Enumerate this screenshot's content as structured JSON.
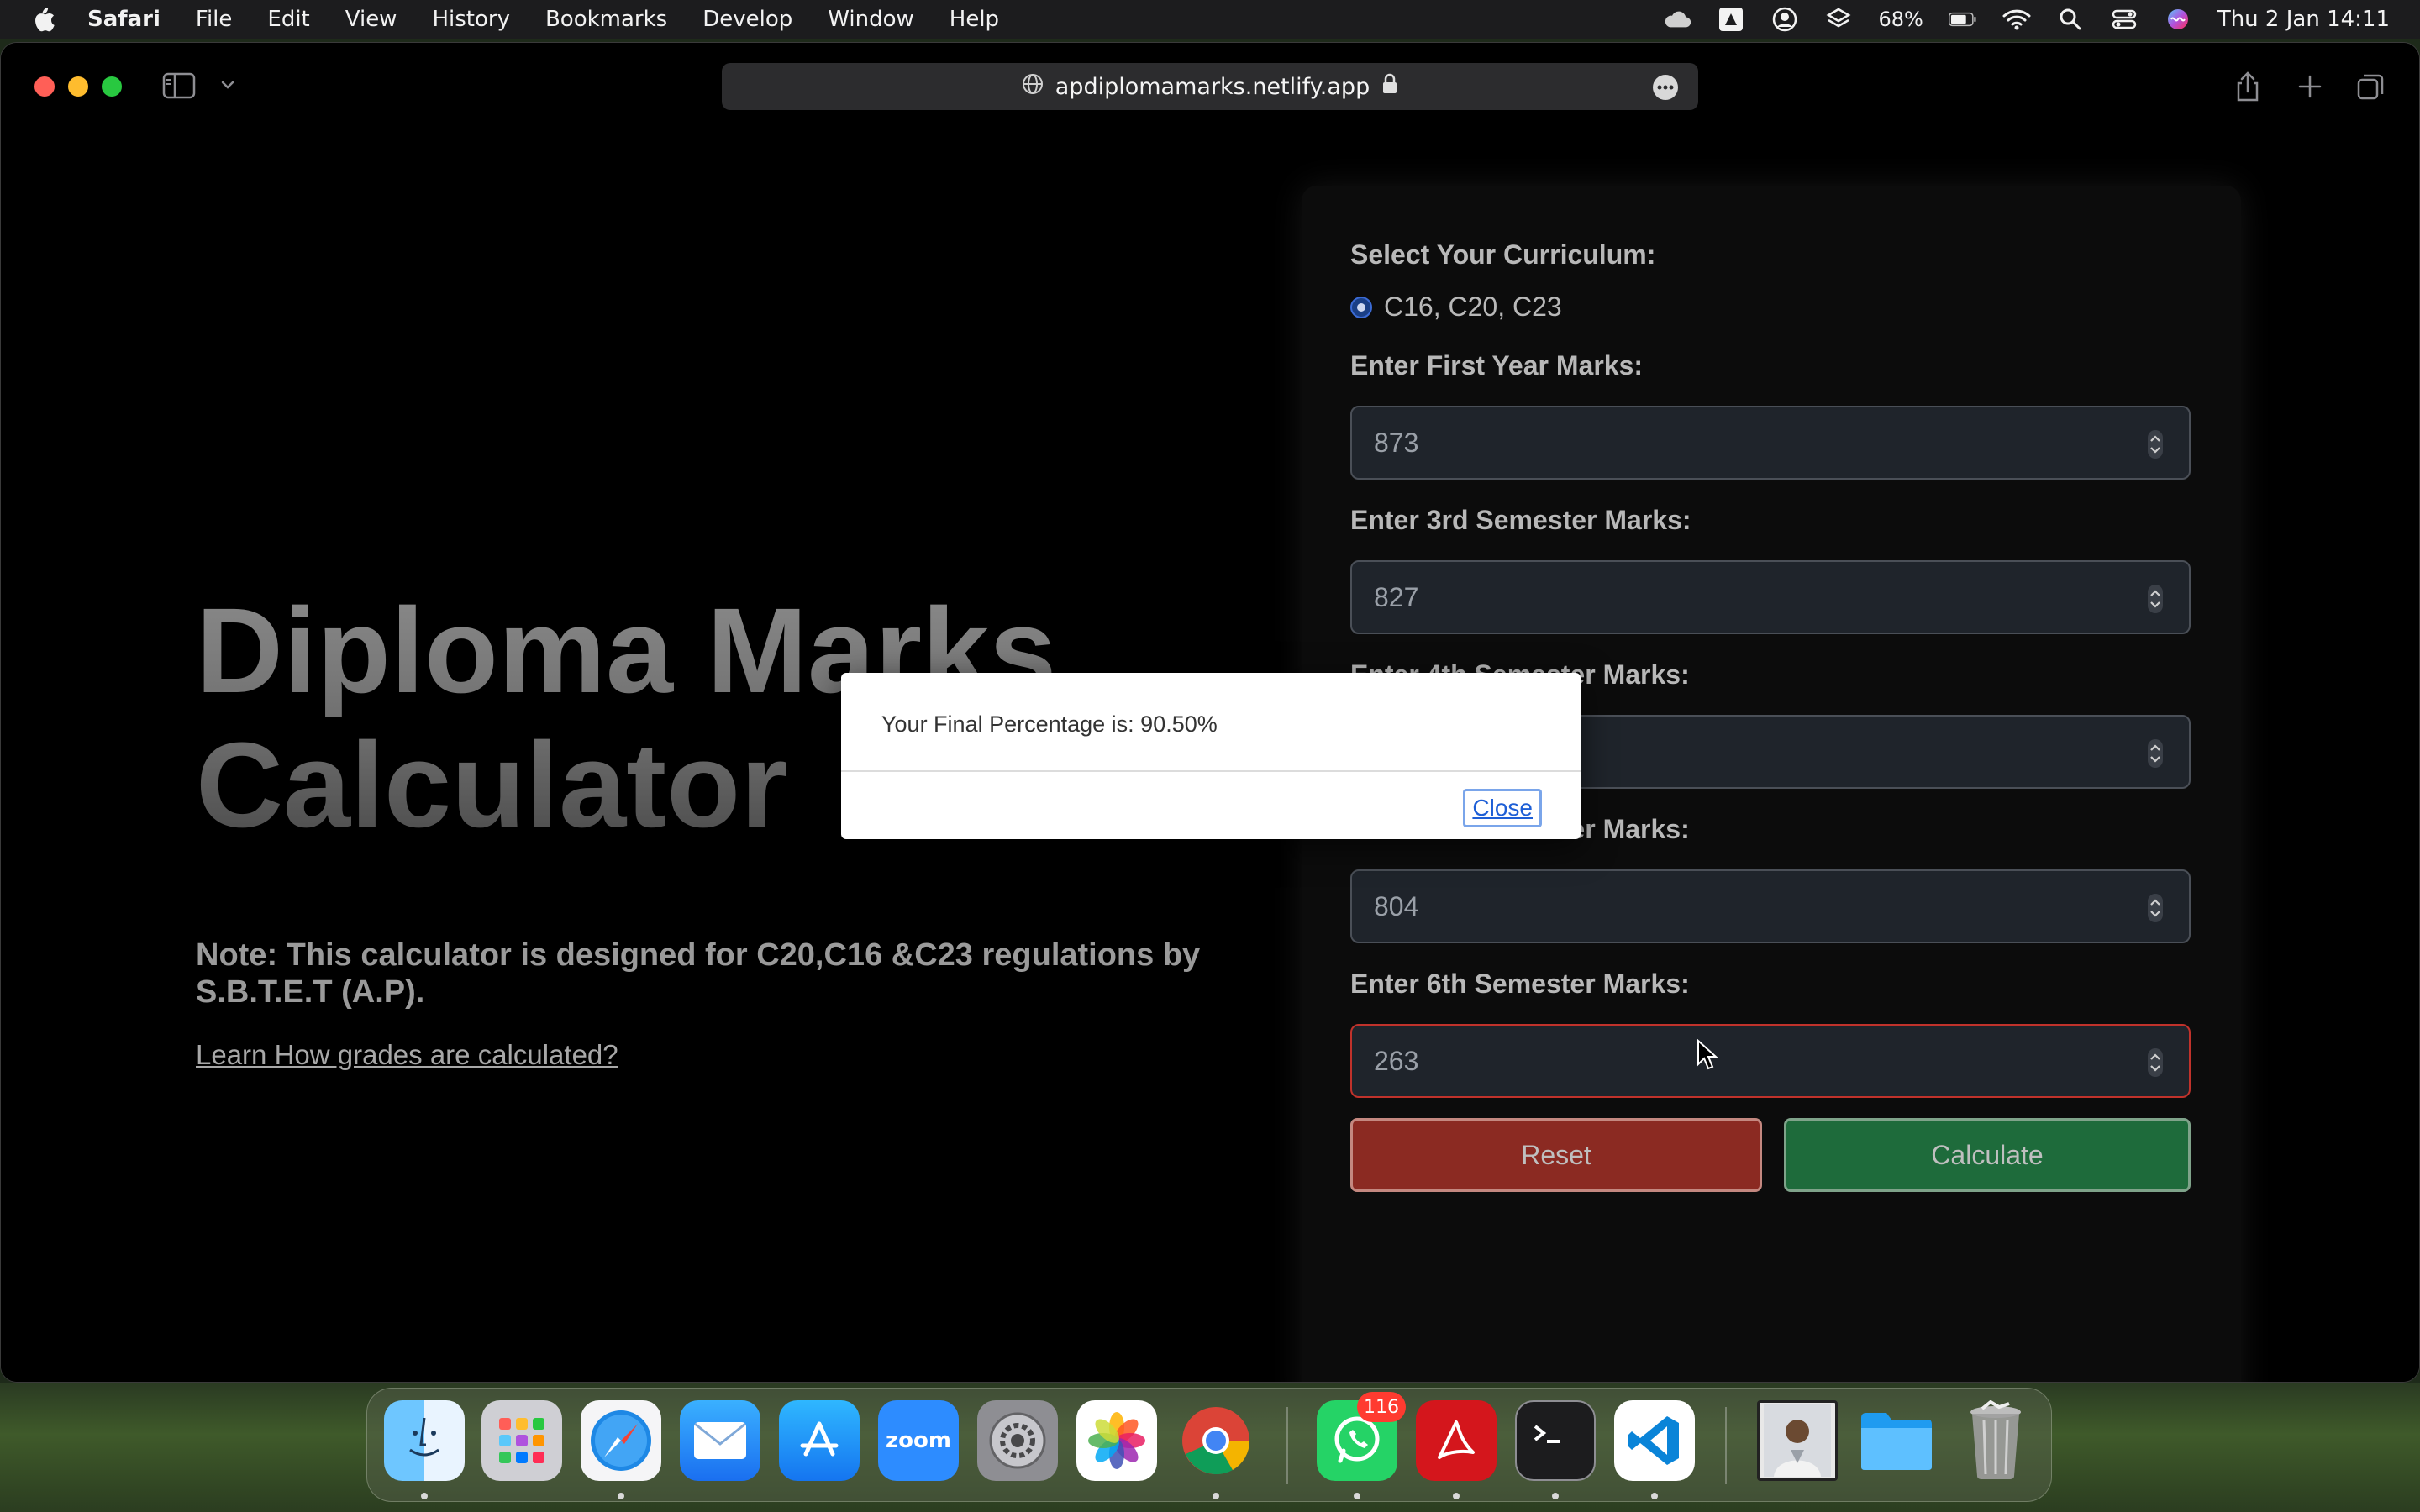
{
  "menubar": {
    "app_name": "Safari",
    "menus": [
      "File",
      "Edit",
      "View",
      "History",
      "Bookmarks",
      "Develop",
      "Window",
      "Help"
    ],
    "battery_percent": "68%",
    "clock": "Thu 2 Jan  14:11"
  },
  "browser": {
    "url": "apdiplomamarks.netlify.app"
  },
  "page": {
    "title_line1": "Diploma Marks",
    "title_line2": "Calculator",
    "note": "Note: This calculator is designed for C20,C16 &C23 regulations by S.B.T.E.T (A.P).",
    "learn_link": "Learn How grades are calculated?"
  },
  "form": {
    "curriculum_label": "Select Your Curriculum:",
    "curriculum_option": "C16, C20, C23",
    "first_year_label": "Enter First Year Marks:",
    "first_year_value": "873",
    "sem3_label": "Enter 3rd Semester Marks:",
    "sem3_value": "827",
    "sem4_label": "Enter 4th Semester Marks:",
    "sem4_value": "",
    "sem5_label": "Enter 5th Semester Marks:",
    "sem5_value": "804",
    "sem6_label": "Enter 6th Semester Marks:",
    "sem6_value": "263",
    "reset_label": "Reset",
    "calculate_label": "Calculate"
  },
  "dialog": {
    "message": "Your Final Percentage is: 90.50%",
    "close_label": "Close"
  },
  "dock": {
    "apps": [
      "Finder",
      "Launchpad",
      "Safari",
      "Mail",
      "App Store",
      "Zoom",
      "System Settings",
      "Photos",
      "Chrome",
      "WhatsApp",
      "Acrobat",
      "Terminal",
      "VS Code",
      "Photo",
      "Folder",
      "Trash"
    ],
    "whatsapp_badge": "116",
    "zoom_label": "zoom"
  },
  "colors": {
    "reset": "#8b2a22",
    "calculate": "#1e6b3b",
    "radio": "#1a3f86",
    "invalid_border": "#c0322b"
  }
}
